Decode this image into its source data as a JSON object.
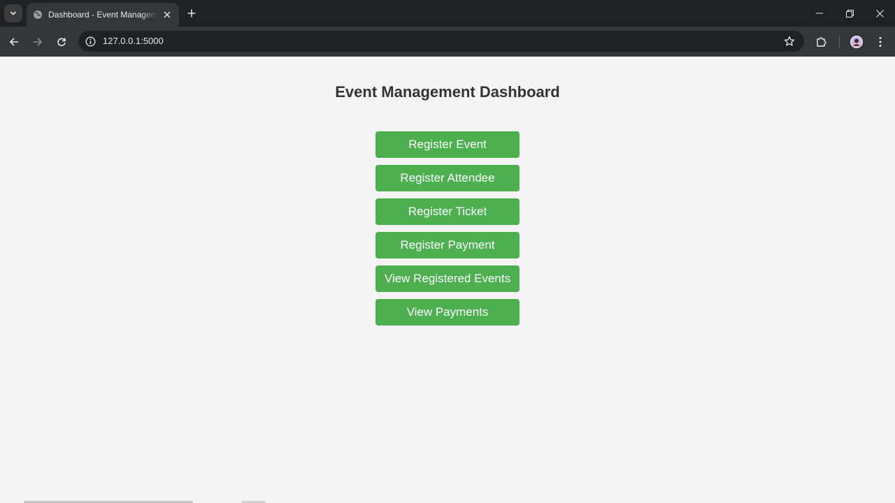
{
  "browser": {
    "tab_title": "Dashboard - Event Management",
    "url": "127.0.0.1:5000",
    "icons": {
      "tab_menu": "chevron-down-icon",
      "favicon": "globe-icon",
      "close": "close-icon",
      "new_tab": "plus-icon",
      "back": "back-arrow-icon",
      "forward": "forward-arrow-icon",
      "reload": "reload-icon",
      "info": "info-icon",
      "bookmark": "star-icon",
      "extensions": "puzzle-icon",
      "profile": "avatar",
      "menu": "more-vertical-icon"
    }
  },
  "page": {
    "title": "Event Management Dashboard",
    "buttons": [
      {
        "label": "Register Event"
      },
      {
        "label": "Register Attendee"
      },
      {
        "label": "Register Ticket"
      },
      {
        "label": "Register Payment"
      },
      {
        "label": "View Registered Events"
      },
      {
        "label": "View Payments"
      }
    ]
  },
  "colors": {
    "button_bg": "#4caf50",
    "page_bg": "#f4f4f4",
    "title_text": "#333333"
  }
}
